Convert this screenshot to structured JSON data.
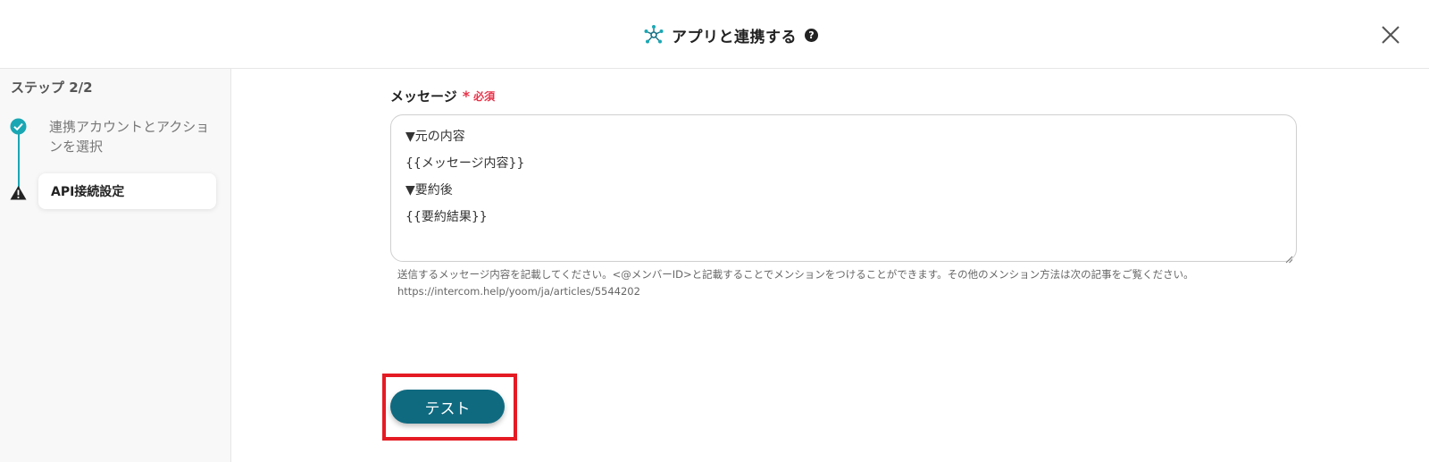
{
  "header": {
    "title": "アプリと連携する",
    "help_icon": "?",
    "icon": "hub-network-icon",
    "close_icon": "close-icon"
  },
  "sidebar": {
    "step_header": "ステップ 2/2",
    "steps": [
      {
        "label": "連携アカウントとアクションを選択",
        "status": "complete"
      },
      {
        "label": "API接続設定",
        "status": "warning"
      }
    ]
  },
  "form": {
    "message_label": "メッセージ",
    "required_mark": "*",
    "required_text": "必須",
    "message_lines": [
      "▼元の内容",
      "{{メッセージ内容}}",
      "▼要約後",
      "{{要約結果}}"
    ],
    "help_text": "送信するメッセージ内容を記載してください。<@メンバーID>と記載することでメンションをつけることができます。その他のメンション方法は次の記事をご覧ください。",
    "help_url": "https://intercom.help/yoom/ja/articles/5544202"
  },
  "actions": {
    "test_label": "テスト"
  },
  "colors": {
    "accent": "#0f6a80",
    "step_line": "#1aa7b4",
    "required": "#e8334a",
    "highlight": "#e51b24"
  }
}
